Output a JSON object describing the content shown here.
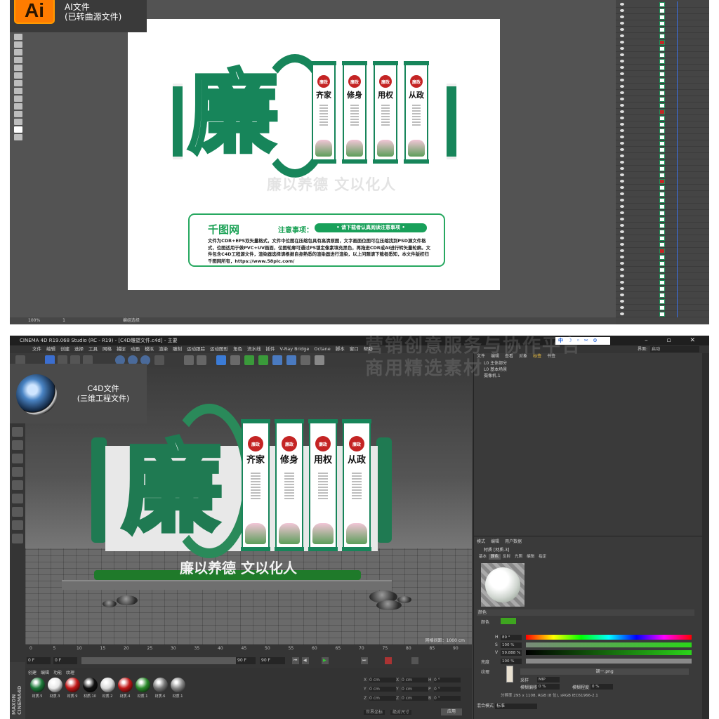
{
  "ai": {
    "badge": {
      "logo_text": "Ai",
      "line1": "AI文件",
      "line2": "(已转曲源文件)"
    },
    "status": {
      "zoom": "100%",
      "page": "1",
      "tool": "编组选择"
    },
    "design": {
      "character": "廉",
      "panels": [
        {
          "seal": "廉政",
          "title": "齐家"
        },
        {
          "seal": "廉政",
          "title": "修身"
        },
        {
          "seal": "廉政",
          "title": "用权"
        },
        {
          "seal": "廉政",
          "title": "从政"
        }
      ],
      "slogan": "廉以养德 文以化人"
    },
    "notice": {
      "logo": "千图网",
      "heading": "注意事项：",
      "pill": "• 请下载者认真阅读注意事项 •",
      "body": "文件为CDR+EPS双矢量格式，文件中位图在压缩包具有高清原图，文字画面位图可在压缩找到PSD源文件格式，位图适用于做PVC+UV画面，位图轮廓可通过PS锁定像素填充黑色，再拖进CDR或AI进行转矢量轮廓。文件包含C4D工程源文件，渲染器选择请根据自身熟悉的渲染器进行渲染，以上问题请下载者悉知，本文件版权归千图网所有，https://www.58pic.com/"
    }
  },
  "c4d": {
    "titlebar": "CINEMA 4D R19.068 Studio (RC - R19) - [C4D雕塑文件.c4d] - 主要",
    "window_buttons": "– ▫ ✕",
    "menu": [
      "文件",
      "编辑",
      "创建",
      "选择",
      "工具",
      "网格",
      "捕捉",
      "动画",
      "模拟",
      "渲染",
      "雕刻",
      "运动跟踪",
      "运动图形",
      "角色",
      "流水线",
      "插件",
      "V-Ray Bridge",
      "Octane",
      "脚本",
      "窗口",
      "帮助"
    ],
    "ime": "中 ☽ ◦ ✂ ⚙",
    "layout_label": "界面:",
    "layout_value": "启动",
    "badge": {
      "line1": "C4D文件",
      "line2": "(三维工程文件)"
    },
    "viewport": {
      "slogan": "廉以养德 文以化人",
      "character": "廉",
      "panels": [
        {
          "seal": "廉政",
          "title": "齐家"
        },
        {
          "seal": "廉政",
          "title": "修身"
        },
        {
          "seal": "廉政",
          "title": "用权"
        },
        {
          "seal": "廉政",
          "title": "从政"
        }
      ],
      "grid_scale": "网格间距：1000 cm"
    },
    "timeline": {
      "ticks": [
        "0",
        "5",
        "10",
        "15",
        "20",
        "25",
        "30",
        "35",
        "40",
        "45",
        "50",
        "55",
        "60",
        "65",
        "70",
        "75",
        "80",
        "85",
        "90"
      ],
      "start": "0 F",
      "end": "90 F",
      "end2": "90 F",
      "current": "0 F"
    },
    "materials": {
      "menu": [
        "创建",
        "编辑",
        "功能",
        "纹理"
      ],
      "items": [
        {
          "name": "材质.5",
          "color": "#1d7a3a"
        },
        {
          "name": "材质.3",
          "color": "#e8e8e8"
        },
        {
          "name": "材质.9",
          "color": "#c21818"
        },
        {
          "name": "材质.10",
          "color": "#111111"
        },
        {
          "name": "材质.2",
          "color": "#d8d8d8"
        },
        {
          "name": "材质.4",
          "color": "#c21818"
        },
        {
          "name": "材质.1",
          "color": "#2a8a2a"
        },
        {
          "name": "材质.6",
          "color": "#777777"
        },
        {
          "name": "材质.1",
          "color": "#888888"
        }
      ]
    },
    "coords": {
      "rows": [
        {
          "a": "X",
          "v1": "0 cm",
          "b": "X",
          "v2": "0 cm",
          "c": "H",
          "v3": "0 °"
        },
        {
          "a": "Y",
          "v1": "0 cm",
          "b": "Y",
          "v2": "0 cm",
          "c": "P",
          "v3": "0 °"
        },
        {
          "a": "Z",
          "v1": "0 cm",
          "b": "Z",
          "v2": "0 cm",
          "c": "B",
          "v3": "0 °"
        }
      ],
      "mode1": "世界坐标",
      "mode2": "绝对尺寸",
      "apply": "应用"
    },
    "objects": {
      "tabs": [
        "文件",
        "编辑",
        "查看",
        "对象",
        "标签",
        "书签"
      ],
      "active_tab": "标签",
      "rows": [
        "L0 主体部分",
        "L0 基本场景",
        "摄像机.1"
      ]
    },
    "attributes": {
      "menu": [
        "模式",
        "编辑",
        "用户数据"
      ],
      "name": "材质 [材质.3]",
      "tabs": [
        "基本",
        "颜色",
        "反射",
        "光照",
        "编辑",
        "指定"
      ],
      "active_tab": "颜色",
      "section": "颜色",
      "color_label": "颜色",
      "h_label": "H",
      "h_value": "89 °",
      "s_label": "S",
      "s_value": "100 %",
      "v_label": "V",
      "v_value": "59.888 %",
      "brightness_label": "亮度",
      "brightness_value": "100 %",
      "texture_label": "纹理",
      "texture_file": "调一.png",
      "sampling_label": "采样",
      "sampling_value": "MIP",
      "blur_offset_label": "模糊偏移",
      "blur_offset_value": "0 %",
      "blur_scale_label": "模糊程度",
      "blur_scale_value": "0 %",
      "tex_info": "分辨率 295 x 1108, RGB (8 位), sRGB IEC61966-2.1",
      "mix_label": "混合模式",
      "mix_value": "标准"
    }
  },
  "watermark": {
    "line1": "营销创意服务与协作平台",
    "line2": "商用精选素材"
  },
  "colors": {
    "brand_green": "#17855a",
    "seal_red": "#c42424",
    "ai_orange": "#ff7c00"
  }
}
